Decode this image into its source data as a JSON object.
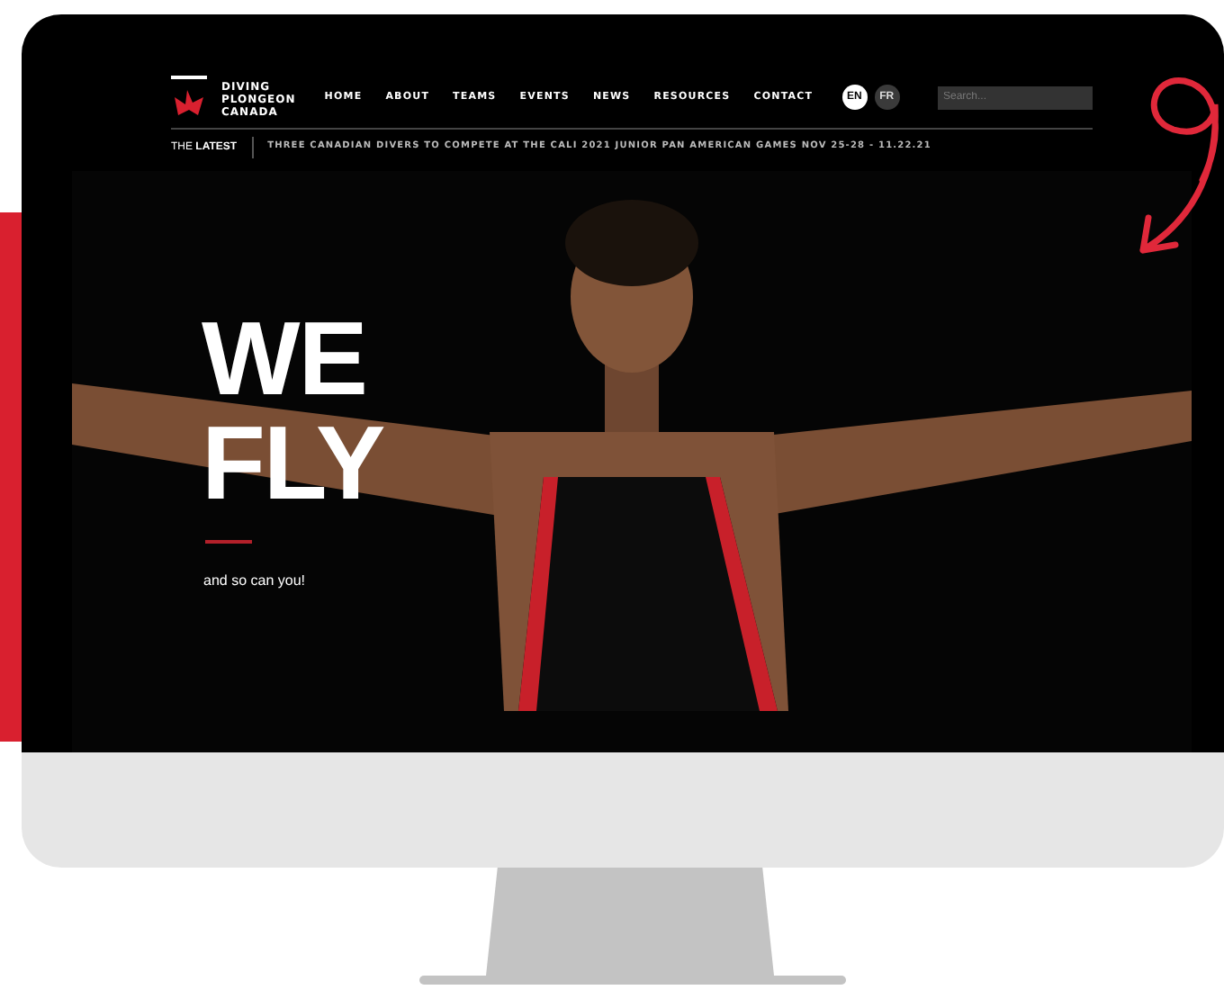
{
  "logo": {
    "lines": [
      "DIVING",
      "PLONGEON",
      "CANADA"
    ]
  },
  "nav": [
    {
      "label": "HOME"
    },
    {
      "label": "ABOUT"
    },
    {
      "label": "TEAMS"
    },
    {
      "label": "EVENTS"
    },
    {
      "label": "NEWS"
    },
    {
      "label": "RESOURCES"
    },
    {
      "label": "CONTACT"
    }
  ],
  "languages": [
    {
      "label": "EN",
      "selected": true
    },
    {
      "label": "FR",
      "selected": false
    }
  ],
  "search": {
    "placeholder": "Search..."
  },
  "ticker": {
    "label": "THE **LATEST**",
    "headline": "THREE CANADIAN DIVERS TO COMPETE AT THE CALI 2021 JUNIOR PAN AMERICAN GAMES NOV 25-28 - 11.22.21"
  },
  "hero": {
    "title_lines": [
      "WE",
      "FLY"
    ],
    "tagline": "and so can you!"
  }
}
